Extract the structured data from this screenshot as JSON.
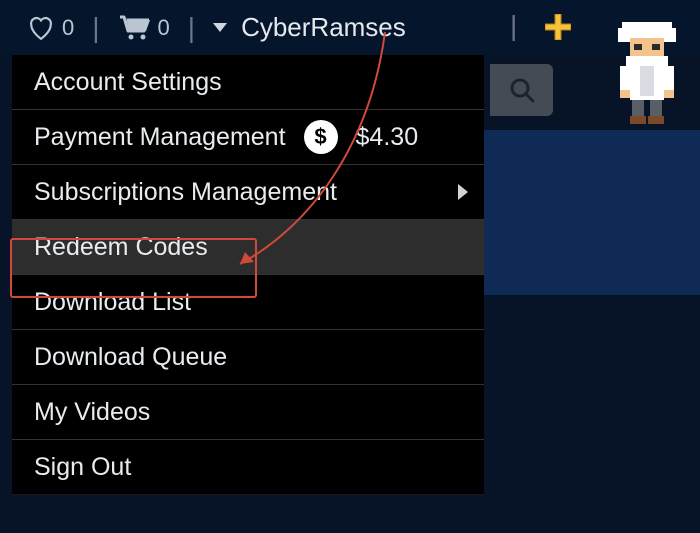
{
  "topbar": {
    "wishlist_count": "0",
    "cart_count": "0",
    "username": "CyberRamses"
  },
  "menu": {
    "items": [
      {
        "label": "Account Settings"
      },
      {
        "label": "Payment Management",
        "balance": "$4.30"
      },
      {
        "label": "Subscriptions Management"
      },
      {
        "label": "Redeem Codes"
      },
      {
        "label": "Download List"
      },
      {
        "label": "Download Queue"
      },
      {
        "label": "My Videos"
      },
      {
        "label": "Sign Out"
      }
    ]
  }
}
